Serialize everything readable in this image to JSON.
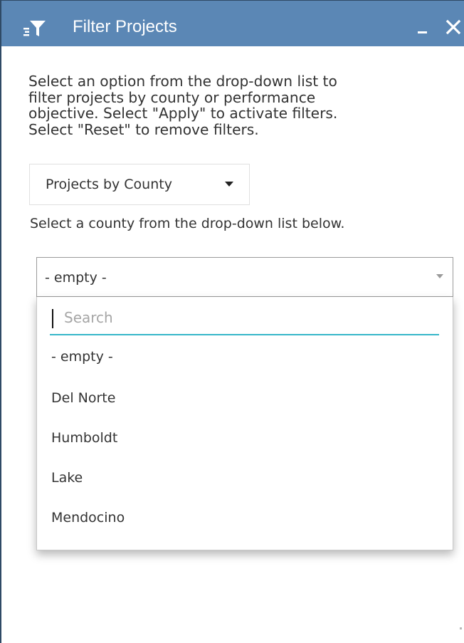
{
  "window": {
    "title": "Filter Projects",
    "title_icon": "filter-icon",
    "minimize_icon": "minimize-icon",
    "close_icon": "close-icon",
    "titlebar_color": "#5b87b5"
  },
  "intro": {
    "lines": [
      "Select an option from the drop-down list to",
      "filter projects by county or performance",
      "objective. Select \"Apply\" to activate filters.",
      "Select \"Reset\" to remove filters."
    ]
  },
  "mode_select": {
    "value": "Projects by County",
    "icon": "caret-down-icon"
  },
  "helper_text": "Select a county from the drop-down list below.",
  "county_select": {
    "value": "- empty -",
    "icon": "chevron-down-icon"
  },
  "dropdown": {
    "search_placeholder": "Search",
    "search_value": "",
    "focus_color": "#36b6c9",
    "options": [
      "- empty -",
      "Del Norte",
      "Humboldt",
      "Lake",
      "Mendocino"
    ]
  }
}
